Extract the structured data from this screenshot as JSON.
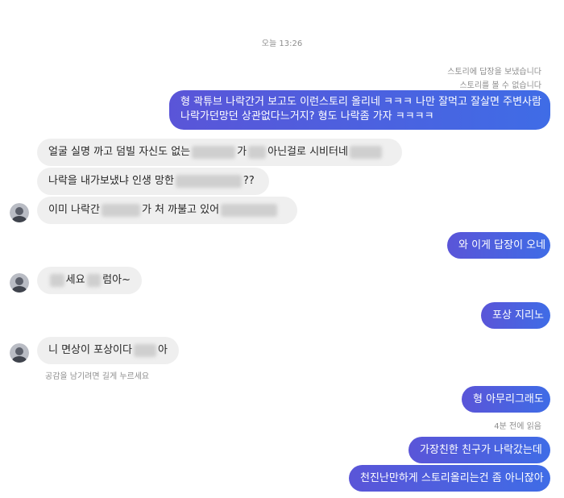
{
  "timestamp": "오늘 13:26",
  "story_notices": [
    "스토리에 답장을 보냈습니다",
    "스토리를 볼 수 없습니다"
  ],
  "messages": {
    "out1_line1": "형 곽튜브 나락간거 보고도 이런스토리 올리네 ㅋㅋㅋ 나만 잘먹고 잘살면 주변사람",
    "out1_line2": "나락가던망던 상관없다느거지? 형도 나락좀 가자 ㅋㅋㅋㅋ",
    "in1_a": "얼굴 실명 까고 덤빌 자신도 없는",
    "in1_b": "가",
    "in1_c": "아닌걸로 시비터네",
    "in2_a": "나락을 내가보냈냐 인생 망한",
    "in2_b": "??",
    "in3_a": "이미 나락간",
    "in3_b": "가 처 까불고 있어",
    "out2": "와 이게 답장이 오네",
    "in4_a": "세요",
    "in4_b": "럼아~",
    "out3": "포상 지리노",
    "in5_a": "니 면상이 포상이다",
    "in5_b": "아",
    "out4": "형 아무리그래도",
    "out5": "가장친한 친구가 나락갔는데",
    "out6": "천진난만하게 스토리올리는건 좀 아니잖아"
  },
  "hints": {
    "like_hint": "공감을 남기려면 길게 누르세요",
    "seen_status": "4분 전에 읽음"
  }
}
